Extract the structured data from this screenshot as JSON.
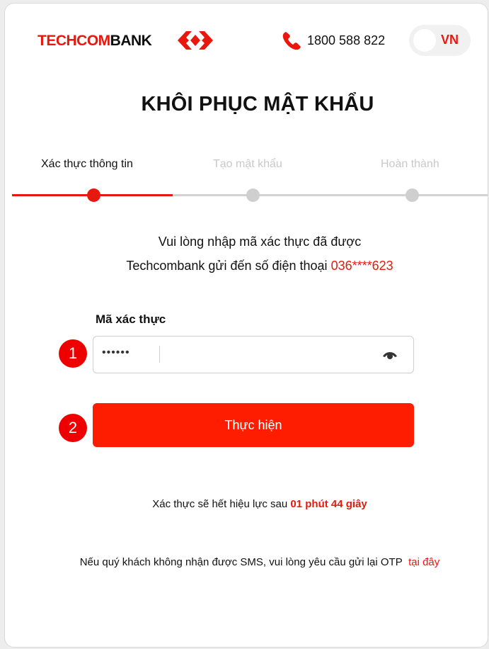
{
  "header": {
    "brand_part1": "TECHCOM",
    "brand_part2": "BANK",
    "phone_icon": "phone-icon",
    "phone_number": "1800 588 822",
    "language": "VN"
  },
  "title": "KHÔI PHỤC MẬT KHẨU",
  "steps": [
    {
      "label": "Xác thực thông tin",
      "state": "active"
    },
    {
      "label": "Tạo mật khẩu",
      "state": "pending"
    },
    {
      "label": "Hoàn thành",
      "state": "pending"
    }
  ],
  "instruction": {
    "line1": "Vui lòng nhập mã xác thực đã được",
    "line2_text": "Techcombank gửi đến số điện thoại",
    "phone_masked": "036****623"
  },
  "otp_field": {
    "label": "Mã xác thực",
    "value": "••••••",
    "toggle_icon": "eye-icon"
  },
  "badges": {
    "first": "1",
    "second": "2"
  },
  "submit_label": "Thực hiện",
  "expiry": {
    "text": "Xác thực sẽ hết hiệu lực sau",
    "countdown": "01 phút 44 giây"
  },
  "resend": {
    "text": "Nếu quý khách không nhận được SMS, vui lòng yêu cầu gửi lại OTP",
    "link_label": "tại đây"
  },
  "colors": {
    "accent": "#e8180f",
    "button": "#ff1d00",
    "inactive": "#c9c9c9"
  }
}
